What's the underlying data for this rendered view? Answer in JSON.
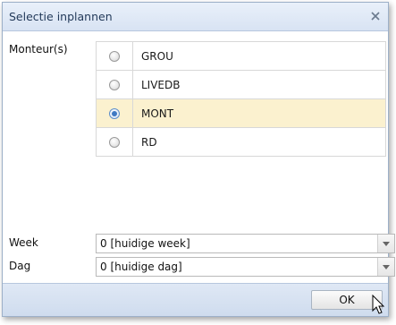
{
  "dialog": {
    "title": "Selectie inplannen",
    "close_icon": "close-icon"
  },
  "monteurs": {
    "label": "Monteur(s)",
    "options": [
      {
        "label": "GROU",
        "selected": false
      },
      {
        "label": "LIVEDB",
        "selected": false
      },
      {
        "label": "MONT",
        "selected": true
      },
      {
        "label": "RD",
        "selected": false
      }
    ]
  },
  "week": {
    "label": "Week",
    "value": "0 [huidige week]"
  },
  "dag": {
    "label": "Dag",
    "value": "0 [huidige dag]"
  },
  "footer": {
    "ok_label": "OK"
  },
  "colors": {
    "selected_row": "#fbf1cf",
    "titlebar": "#dde7f5",
    "radio_checked": "#3f79c2"
  }
}
